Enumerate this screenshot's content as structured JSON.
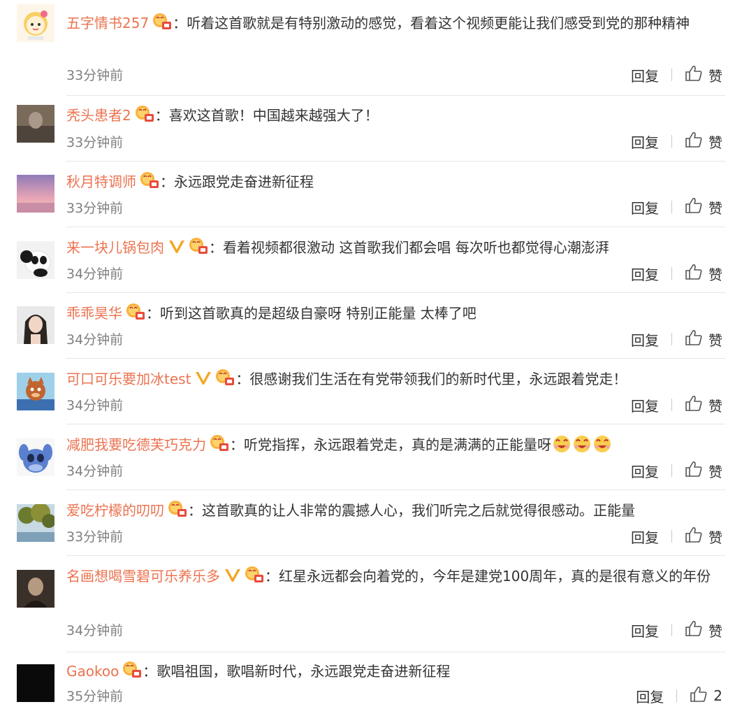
{
  "actions": {
    "reply_label": "回复",
    "like_label": "赞"
  },
  "colors": {
    "username": "#eb7350",
    "text": "#333333",
    "time": "#808080",
    "divider": "#e6e6e6",
    "vip_badge": "#f5a623",
    "medal": "#f08a28"
  },
  "comments": [
    {
      "username": "五字情书257",
      "vip": false,
      "content": "听着这首歌就是有特别激动的感觉，看着这个视频更能让我们感受到党的那种精神",
      "time": "33分钟前",
      "like": "赞",
      "avatar_icon": "cartoon-girl-avatar-icon"
    },
    {
      "username": "秃头患者2",
      "vip": false,
      "content": "喜欢这首歌！中国越来越强大了！",
      "time": "33分钟前",
      "like": "赞",
      "avatar_icon": "photo-avatar-icon"
    },
    {
      "username": "秋月特调师",
      "vip": false,
      "content": "永远跟党走奋进新征程",
      "time": "33分钟前",
      "like": "赞",
      "avatar_icon": "sunset-avatar-icon"
    },
    {
      "username": "来一块儿锅包肉",
      "vip": true,
      "content": "看着视频都很激动 这首歌我们都会唱 每次听也都觉得心潮澎湃",
      "time": "34分钟前",
      "like": "赞",
      "avatar_icon": "panda-avatar-icon"
    },
    {
      "username": "乖乖昊华",
      "vip": false,
      "content": "听到这首歌真的是超级自豪呀 特别正能量 太棒了吧",
      "time": "34分钟前",
      "like": "赞",
      "avatar_icon": "girl-photo-avatar-icon"
    },
    {
      "username": "可口可乐要加冰test",
      "vip": true,
      "content": "很感谢我们生活在有党带领我们的新时代里，永远跟着党走！",
      "time": "34分钟前",
      "like": "赞",
      "avatar_icon": "cartoon-cat-avatar-icon"
    },
    {
      "username": "减肥我要吃德芙巧克力",
      "vip": false,
      "content": "听党指挥，永远跟着党走，真的是满满的正能量呀",
      "emoji_count": 3,
      "time": "34分钟前",
      "like": "赞",
      "avatar_icon": "stitch-avatar-icon"
    },
    {
      "username": "爱吃柠檬的叨叨",
      "vip": false,
      "content": "这首歌真的让人非常的震撼人心，我们听完之后就觉得很感动。正能量",
      "time": "33分钟前",
      "like": "赞",
      "avatar_icon": "tree-avatar-icon"
    },
    {
      "username": "名画想喝雪碧可乐养乐多",
      "vip": true,
      "content": "红星永远都会向着党的，今年是建党100周年，真的是很有意义的年份",
      "time": "34分钟前",
      "like": "赞",
      "avatar_icon": "portrait-avatar-icon"
    },
    {
      "username": "Gaokoo",
      "vip": false,
      "content": "歌唱祖国，歌唱新时代，永远跟党走奋进新征程",
      "time": "35分钟前",
      "like": "2",
      "avatar_icon": "black-avatar-icon"
    }
  ]
}
